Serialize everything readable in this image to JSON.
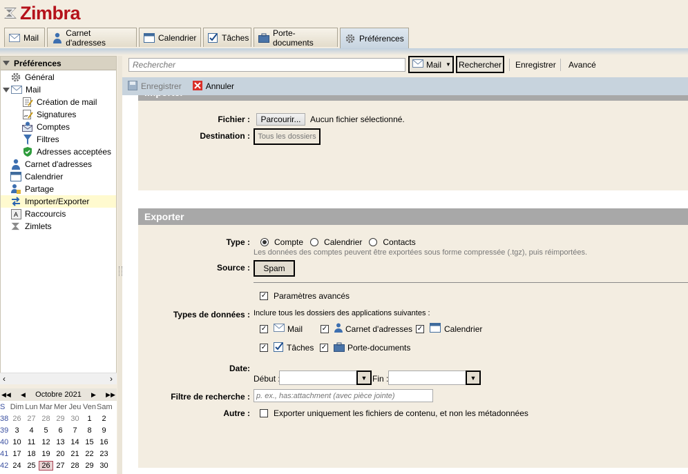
{
  "app": {
    "logo_text": "Zimbra"
  },
  "apptabs": [
    {
      "label": "Mail",
      "icon": "mail-icon"
    },
    {
      "label": "Carnet d'adresses",
      "icon": "contacts-icon"
    },
    {
      "label": "Calendrier",
      "icon": "calendar-icon"
    },
    {
      "label": "Tâches",
      "icon": "tasks-icon"
    },
    {
      "label": "Porte-documents",
      "icon": "briefcase-icon"
    },
    {
      "label": "Préférences",
      "icon": "gear-icon"
    }
  ],
  "sidebar": {
    "header": "Préférences",
    "items": [
      {
        "label": "Général"
      },
      {
        "label": "Mail"
      },
      {
        "label": "Création de mail"
      },
      {
        "label": "Signatures"
      },
      {
        "label": "Comptes"
      },
      {
        "label": "Filtres"
      },
      {
        "label": "Adresses acceptées"
      },
      {
        "label": "Carnet d'adresses"
      },
      {
        "label": "Calendrier"
      },
      {
        "label": "Partage"
      },
      {
        "label": "Importer/Exporter"
      },
      {
        "label": "Raccourcis"
      },
      {
        "label": "Zimlets"
      }
    ]
  },
  "minical": {
    "month": "Octobre 2021",
    "week_header": "S",
    "days": [
      "Dim",
      "Lun",
      "Mar",
      "Mer",
      "Jeu",
      "Ven",
      "Sam"
    ],
    "weeks": [
      {
        "wk": "38",
        "d": [
          "26",
          "27",
          "28",
          "29",
          "30",
          "1",
          "2"
        ]
      },
      {
        "wk": "39",
        "d": [
          "3",
          "4",
          "5",
          "6",
          "7",
          "8",
          "9"
        ]
      },
      {
        "wk": "40",
        "d": [
          "10",
          "11",
          "12",
          "13",
          "14",
          "15",
          "16"
        ]
      },
      {
        "wk": "41",
        "d": [
          "17",
          "18",
          "19",
          "20",
          "21",
          "22",
          "23"
        ]
      },
      {
        "wk": "42",
        "d": [
          "24",
          "25",
          "26",
          "27",
          "28",
          "29",
          "30"
        ]
      }
    ],
    "today": "26"
  },
  "search": {
    "placeholder": "Rechercher",
    "scope": "Mail",
    "search_button": "Rechercher",
    "save_link": "Enregistrer",
    "advanced_link": "Avancé"
  },
  "toolbar": {
    "save": "Enregistrer",
    "cancel": "Annuler"
  },
  "import": {
    "title": "Importer",
    "file_label": "Fichier :",
    "browse_button": "Parcourir...",
    "no_file": "Aucun fichier sélectionné.",
    "destination_label": "Destination :",
    "destination_value": "Tous les dossiers"
  },
  "export": {
    "title": "Exporter",
    "type_label": "Type :",
    "types": [
      "Compte",
      "Calendrier",
      "Contacts"
    ],
    "type_hint": "Les données des comptes peuvent être exportées sous forme compressée (.tgz), puis réimportées.",
    "source_label": "Source :",
    "source_value": "Spam",
    "advanced_params": "Paramètres avancés",
    "data_types_label": "Types de données :",
    "data_types_hint": "Inclure tous les dossiers des applications suivantes :",
    "data_types": [
      "Mail",
      "Carnet d'adresses",
      "Calendrier",
      "Tâches",
      "Porte-documents"
    ],
    "date_label": "Date:",
    "start_label": "Début :",
    "end_label": "Fin :",
    "filter_label": "Filtre de recherche :",
    "filter_placeholder": "p. ex., has:attachment (avec pièce jointe)",
    "other_label": "Autre :",
    "other_option": "Exporter uniquement les fichiers de contenu, et non les métadonnées"
  }
}
